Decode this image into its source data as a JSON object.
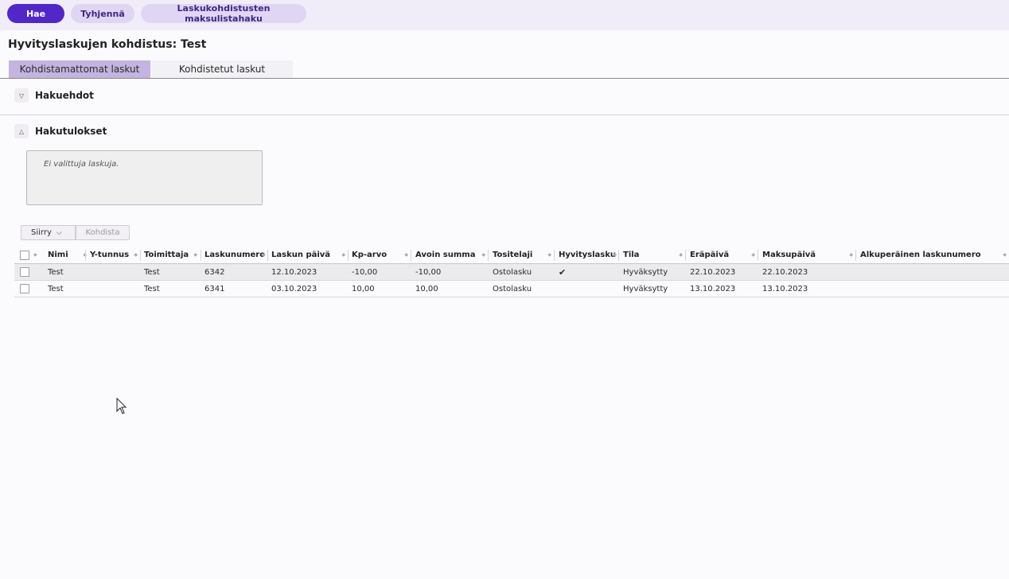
{
  "toolbar": {
    "search_label": "Hae",
    "clear_label": "Tyhjennä",
    "payment_search_label": "Laskukohdistusten maksulistahaku"
  },
  "page": {
    "title": "Hyvityslaskujen kohdistus: Test"
  },
  "tabs": [
    {
      "label": "Kohdistamattomat laskut",
      "active": true
    },
    {
      "label": "Kohdistetut laskut",
      "active": false
    }
  ],
  "sections": {
    "criteria": {
      "label": "Hakuehdot",
      "expanded": false
    },
    "results": {
      "label": "Hakutulokset",
      "expanded": true
    }
  },
  "selection": {
    "empty_text": "Ei valittuja laskuja."
  },
  "actions": {
    "move_label": "Siirry",
    "allocate_label": "Kohdista"
  },
  "table": {
    "columns": [
      "Nimi",
      "Y-tunnus",
      "Toimittaja",
      "Laskunumero",
      "Laskun päivä",
      "Kp-arvo",
      "Avoin summa",
      "Tositelaji",
      "Hyvityslasku",
      "Tila",
      "Eräpäivä",
      "Maksupäivä",
      "Alkuperäinen laskunumero"
    ],
    "rows": [
      {
        "cells": [
          "Test",
          "",
          "Test",
          "6342",
          "12.10.2023",
          "-10,00",
          "-10,00",
          "Ostolasku",
          "✔",
          "Hyväksytty",
          "22.10.2023",
          "22.10.2023",
          ""
        ],
        "selected": true
      },
      {
        "cells": [
          "Test",
          "",
          "Test",
          "6341",
          "03.10.2023",
          "10,00",
          "10,00",
          "Ostolasku",
          "",
          "Hyväksytty",
          "13.10.2023",
          "13.10.2023",
          ""
        ],
        "selected": false
      }
    ]
  },
  "colors": {
    "primary": "#5227c7",
    "secondary_button": "#e0d6f3",
    "active_tab": "#c4b4e1",
    "toolbar_bg": "#f1edf8"
  }
}
